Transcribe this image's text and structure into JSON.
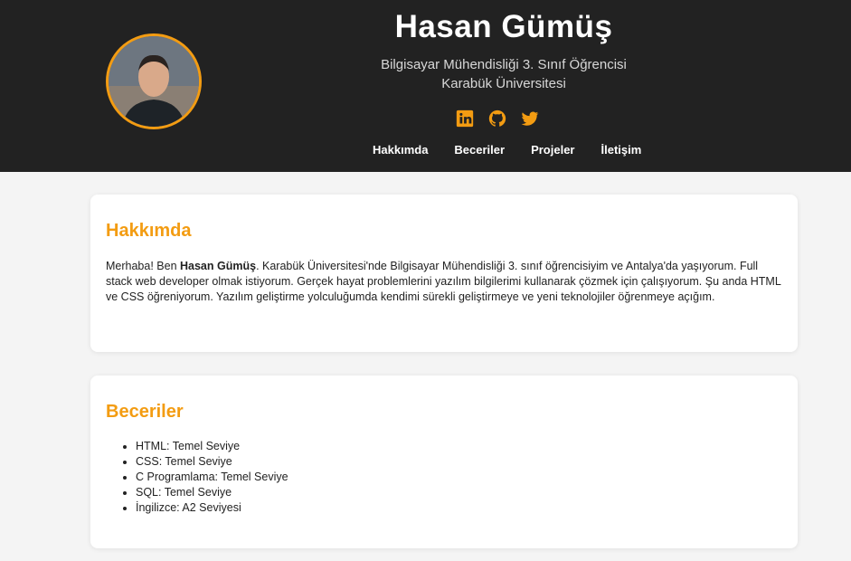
{
  "header": {
    "name": "Hasan Gümüş",
    "subtitle_line1": "Bilgisayar Mühendisliği 3. Sınıf Öğrencisi",
    "subtitle_line2": "Karabük Üniversitesi",
    "socials": [
      "linkedin-icon",
      "github-icon",
      "twitter-icon"
    ],
    "accent_color": "#f39c12",
    "background_color": "#222222"
  },
  "nav": {
    "items": [
      "Hakkımda",
      "Beceriler",
      "Projeler",
      "İletişim"
    ]
  },
  "about": {
    "heading": "Hakkımda",
    "text_before": "Merhaba! Ben ",
    "name_bold": "Hasan Gümüş",
    "text_after": ". Karabük Üniversitesi'nde Bilgisayar Mühendisliği 3. sınıf öğrencisiyim ve Antalya'da yaşıyorum. Full stack web developer olmak istiyorum. Gerçek hayat problemlerini yazılım bilgilerimi kullanarak çözmek için çalışıyorum. Şu anda HTML ve CSS öğreniyorum. Yazılım geliştirme yolculuğumda kendimi sürekli geliştirmeye ve yeni teknolojiler öğrenmeye açığım."
  },
  "skills": {
    "heading": "Beceriler",
    "items": [
      "HTML: Temel Seviye",
      "CSS: Temel Seviye",
      "C Programlama: Temel Seviye",
      "SQL: Temel Seviye",
      "İngilizce: A2 Seviyesi"
    ]
  }
}
